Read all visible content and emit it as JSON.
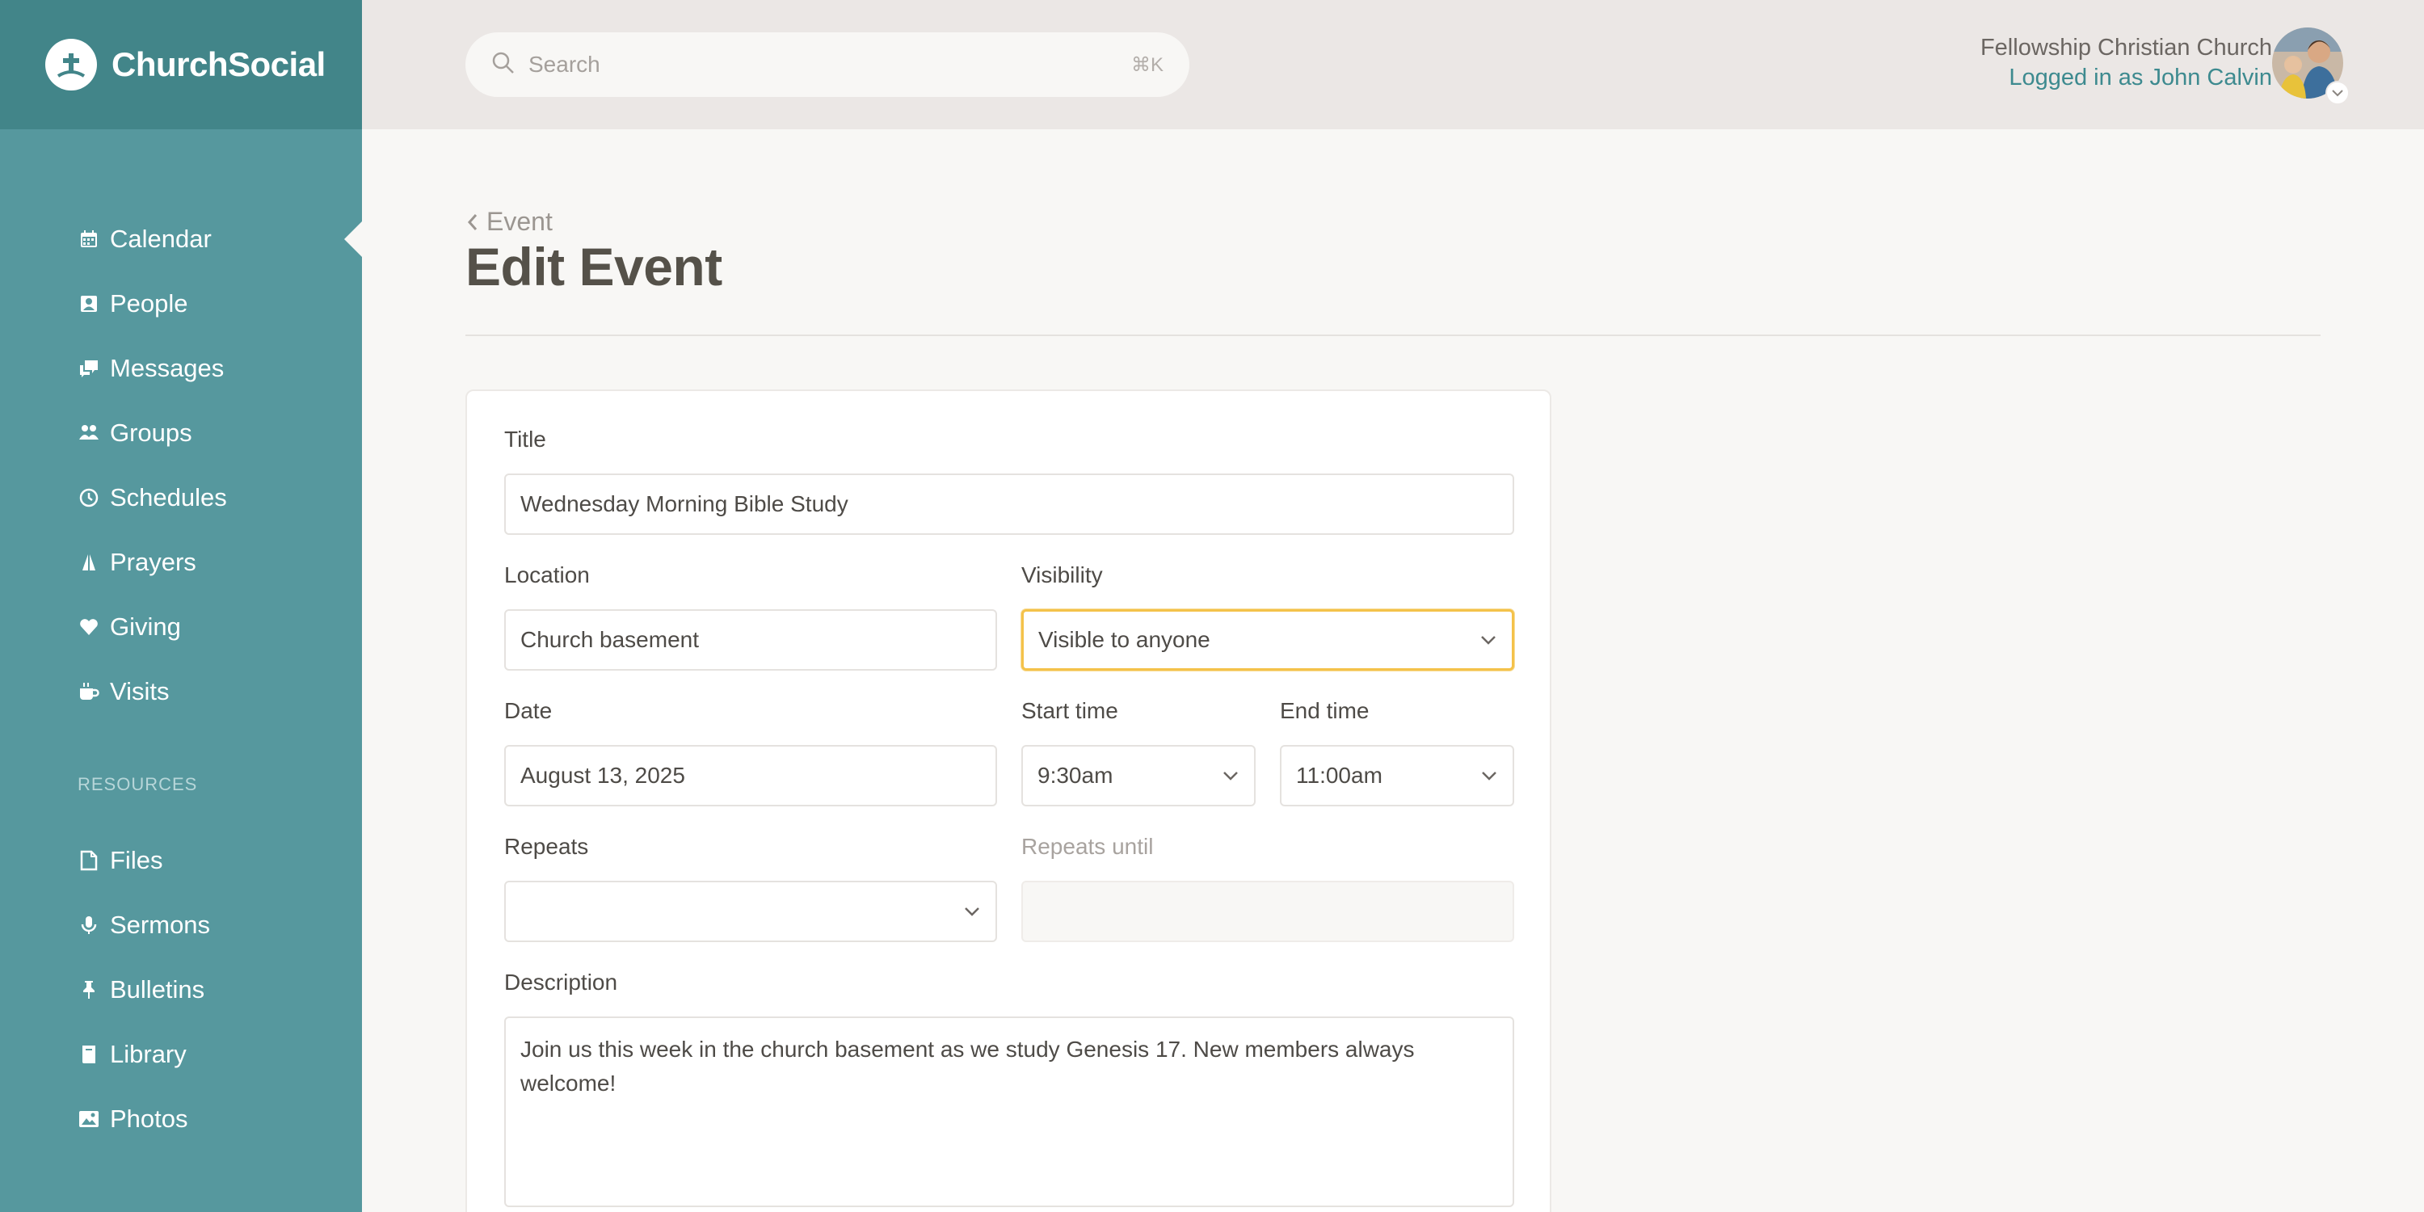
{
  "brand": {
    "name": "ChurchSocial"
  },
  "sidebar": {
    "items": [
      {
        "label": "Calendar",
        "icon": "calendar-icon",
        "active": true
      },
      {
        "label": "People",
        "icon": "contact-card-icon"
      },
      {
        "label": "Messages",
        "icon": "chat-bubbles-icon"
      },
      {
        "label": "Groups",
        "icon": "group-icon"
      },
      {
        "label": "Schedules",
        "icon": "clock-icon"
      },
      {
        "label": "Prayers",
        "icon": "praying-hands-icon"
      },
      {
        "label": "Giving",
        "icon": "heart-icon"
      },
      {
        "label": "Visits",
        "icon": "coffee-cup-icon"
      }
    ],
    "resources_label": "RESOURCES",
    "resources": [
      {
        "label": "Files",
        "icon": "file-icon"
      },
      {
        "label": "Sermons",
        "icon": "microphone-icon"
      },
      {
        "label": "Bulletins",
        "icon": "pushpin-icon"
      },
      {
        "label": "Library",
        "icon": "book-icon"
      },
      {
        "label": "Photos",
        "icon": "image-icon"
      }
    ]
  },
  "header": {
    "search_placeholder": "Search",
    "search_shortcut": "⌘K",
    "org_name": "Fellowship Christian Church",
    "logged_in": "Logged in as John Calvin"
  },
  "page": {
    "breadcrumb": "Event",
    "title": "Edit Event"
  },
  "form": {
    "title_label": "Title",
    "title_value": "Wednesday Morning Bible Study",
    "location_label": "Location",
    "location_value": "Church basement",
    "visibility_label": "Visibility",
    "visibility_value": "Visible to anyone",
    "date_label": "Date",
    "date_value": "August 13, 2025",
    "start_label": "Start time",
    "start_value": "9:30am",
    "end_label": "End time",
    "end_value": "11:00am",
    "repeats_label": "Repeats",
    "repeats_value": "",
    "repeats_until_label": "Repeats until",
    "repeats_until_value": "",
    "description_label": "Description",
    "description_value": "Join us this week in the church basement as we study Genesis 17. New members always welcome!"
  },
  "colors": {
    "sidebar": "#56989e",
    "brand_bar": "#428589",
    "topbar": "#ebe7e5",
    "focus_border": "#f4c24a",
    "link": "#3d8a8f"
  }
}
